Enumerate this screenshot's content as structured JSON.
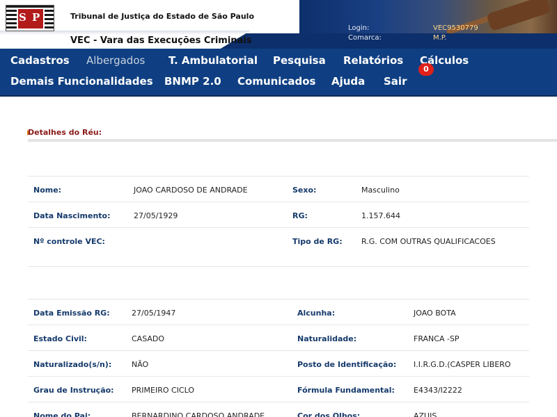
{
  "header": {
    "court_name": "Tribunal de Justiça do Estado de São Paulo",
    "system_title": "VEC - Vara das Execuções Criminais",
    "logo_text_left": "S",
    "logo_text_right": "P",
    "login_label": "Login:",
    "login_value": "VEC9530779",
    "comarca_label": "Comarca:",
    "comarca_value": "M.P."
  },
  "nav": {
    "row1": [
      "Cadastros",
      "Albergados",
      "T. Ambulatorial",
      "Pesquisa",
      "Relatórios",
      "Cálculos"
    ],
    "row2": [
      "Demais Funcionalidades",
      "BNMP 2.0",
      "Comunicados",
      "Ajuda",
      "Sair"
    ],
    "notification_count": "0",
    "bell_glyph": ""
  },
  "section": {
    "title": "Detalhes do Réu:"
  },
  "table1": [
    {
      "l1": "Nome:",
      "v1": "JOAO CARDOSO DE ANDRADE",
      "l2": "Sexo:",
      "v2": "Masculino"
    },
    {
      "l1": "Data Nascimento:",
      "v1": "27/05/1929",
      "l2": "RG:",
      "v2": "1.157.644"
    },
    {
      "l1": "Nº controle VEC:",
      "v1": "",
      "l2": "Tipo de RG:",
      "v2": "R.G. COM OUTRAS QUALIFICACOES"
    }
  ],
  "table2": [
    {
      "l1": "Data Emissão RG:",
      "v1": "27/05/1947",
      "l2": "Alcunha:",
      "v2": "JOAO BOTA"
    },
    {
      "l1": "Estado Civil:",
      "v1": "CASADO",
      "l2": "Naturalidade:",
      "v2": "FRANCA -SP"
    },
    {
      "l1": "Naturalizado(s/n):",
      "v1": "NÃO",
      "l2": "Posto de Identificação:",
      "v2": "I.I.R.G.D.(CASPER LIBERO"
    },
    {
      "l1": "Grau de Instrução:",
      "v1": "PRIMEIRO CICLO",
      "l2": "Fórmula Fundamental:",
      "v2": "E4343/I2222"
    },
    {
      "l1": "Nome do Pai:",
      "v1": "BERNARDINO CARDOSO ANDRADE",
      "l2": "Cor dos Olhos:",
      "v2": "AZUIS"
    }
  ],
  "colors": {
    "nav_bg": "#0f3f82",
    "band_bg": "#0d2f6b",
    "label_color": "#153a6b",
    "title_color": "#8b1a1a",
    "badge": "#e0201a"
  }
}
